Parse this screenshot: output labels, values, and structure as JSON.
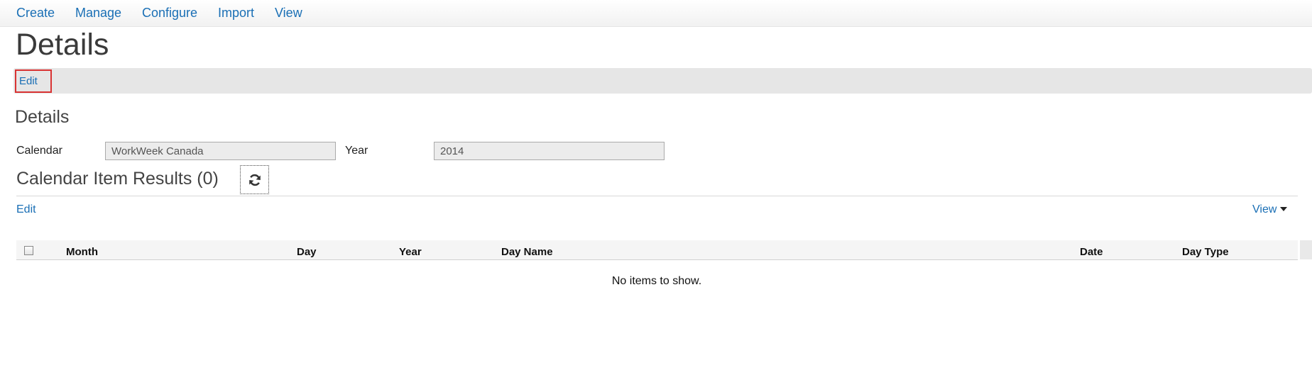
{
  "nav": {
    "items": [
      "Create",
      "Manage",
      "Configure",
      "Import",
      "View"
    ]
  },
  "page": {
    "title": "Details"
  },
  "toolbar": {
    "edit_label": "Edit",
    "highlight_color": "#d93333"
  },
  "details": {
    "section_title": "Details",
    "calendar_label": "Calendar",
    "calendar_value": "WorkWeek Canada",
    "year_label": "Year",
    "year_value": "2014"
  },
  "results": {
    "title": "Calendar Item Results (0)",
    "refresh_icon": "refresh-icon",
    "edit_label": "Edit",
    "view_label": "View",
    "columns": [
      "Month",
      "Day",
      "Year",
      "Day Name",
      "Date",
      "Day Type"
    ],
    "empty_message": "No items to show."
  },
  "colors": {
    "link": "#1a6fb5",
    "toolbar_bg": "#e6e6e6"
  }
}
